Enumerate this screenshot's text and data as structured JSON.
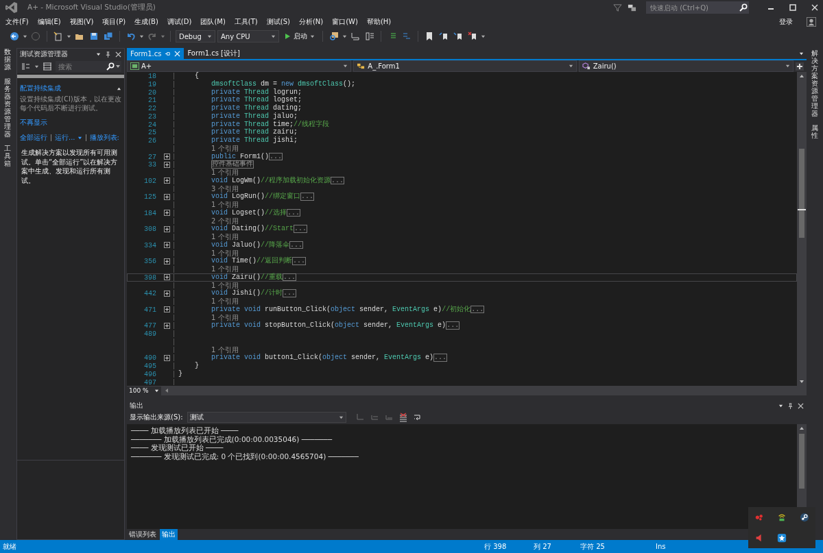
{
  "window": {
    "title": "A+ - Microsoft Visual Studio(管理员)",
    "quick_launch": {
      "placeholder": "快速启动 (Ctrl+Q)"
    },
    "sign_in": "登录"
  },
  "menu": [
    "文件(F)",
    "编辑(E)",
    "视图(V)",
    "项目(P)",
    "生成(B)",
    "调试(D)",
    "团队(M)",
    "工具(T)",
    "测试(S)",
    "分析(N)",
    "窗口(W)",
    "帮助(H)"
  ],
  "toolbar": {
    "configuration": "Debug",
    "platform": "Any CPU",
    "start": "启动"
  },
  "left_strip": [
    "数据源",
    "服务器资源管理器",
    "工具箱"
  ],
  "right_strip": [
    "解决方案资源管理器",
    "属性"
  ],
  "test_explorer": {
    "title": "测试资源管理器",
    "search": {
      "placeholder": "搜索"
    },
    "progress": {
      "level": 1
    },
    "notice_title": "配置持续集成",
    "notice_text": "设置持续集成(CI)版本，以在更改每个代码后不断进行测试。",
    "dismiss": "不再显示",
    "actions": [
      "全部运行",
      "运行...",
      "播放列表:"
    ],
    "message": "生成解决方案以发现所有可用测试。单击“全部运行”以在解决方案中生成、发现和运行所有测试。"
  },
  "editor_tabs": [
    {
      "label": "Form1.cs",
      "selected": true
    },
    {
      "label": "Form1.cs [设计]",
      "selected": false
    }
  ],
  "nav_bar": {
    "project": "A+",
    "class": "A_.Form1",
    "member": "Zairu()"
  },
  "code": [
    {
      "kind": "code",
      "num": "18",
      "folded": false,
      "current": false,
      "tokens": [
        {
          "kind": "text",
          "text": "    {"
        }
      ]
    },
    {
      "kind": "code",
      "num": "19",
      "folded": false,
      "current": false,
      "tokens": [
        {
          "kind": "type",
          "text": "        dmsoftClass"
        },
        {
          "kind": "text",
          "text": " dm = "
        },
        {
          "kind": "kw",
          "text": "new"
        },
        {
          "kind": "type",
          "text": " dmsoftClass"
        },
        {
          "kind": "text",
          "text": "();"
        }
      ]
    },
    {
      "kind": "code",
      "num": "20",
      "folded": false,
      "current": false,
      "tokens": [
        {
          "kind": "kw",
          "text": "        private"
        },
        {
          "kind": "type",
          "text": " Thread"
        },
        {
          "kind": "text",
          "text": " logrun;"
        }
      ]
    },
    {
      "kind": "code",
      "num": "21",
      "folded": false,
      "current": false,
      "tokens": [
        {
          "kind": "kw",
          "text": "        private"
        },
        {
          "kind": "type",
          "text": " Thread"
        },
        {
          "kind": "text",
          "text": " logset;"
        }
      ]
    },
    {
      "kind": "code",
      "num": "22",
      "folded": false,
      "current": false,
      "tokens": [
        {
          "kind": "kw",
          "text": "        private"
        },
        {
          "kind": "type",
          "text": " Thread"
        },
        {
          "kind": "text",
          "text": " dating;"
        }
      ]
    },
    {
      "kind": "code",
      "num": "23",
      "folded": false,
      "current": false,
      "tokens": [
        {
          "kind": "kw",
          "text": "        private"
        },
        {
          "kind": "type",
          "text": " Thread"
        },
        {
          "kind": "text",
          "text": " jaluo;"
        }
      ]
    },
    {
      "kind": "code",
      "num": "24",
      "folded": false,
      "current": false,
      "tokens": [
        {
          "kind": "kw",
          "text": "        private"
        },
        {
          "kind": "type",
          "text": " Thread"
        },
        {
          "kind": "text",
          "text": " time;"
        },
        {
          "kind": "comment",
          "text": "//线程字段"
        }
      ]
    },
    {
      "kind": "code",
      "num": "25",
      "folded": false,
      "current": false,
      "tokens": [
        {
          "kind": "kw",
          "text": "        private"
        },
        {
          "kind": "type",
          "text": " Thread"
        },
        {
          "kind": "text",
          "text": " zairu;"
        }
      ]
    },
    {
      "kind": "code",
      "num": "26",
      "folded": false,
      "current": false,
      "tokens": [
        {
          "kind": "kw",
          "text": "        private"
        },
        {
          "kind": "type",
          "text": " Thread"
        },
        {
          "kind": "text",
          "text": " jishi;"
        }
      ]
    },
    {
      "kind": "lens",
      "text": "1 个引用"
    },
    {
      "kind": "code",
      "num": "27",
      "folded": true,
      "current": false,
      "tokens": [
        {
          "kind": "kw",
          "text": "        public"
        },
        {
          "kind": "text",
          "text": " Form1()"
        },
        {
          "kind": "collapsed",
          "text": "..."
        }
      ]
    },
    {
      "kind": "code",
      "num": "33",
      "folded": true,
      "current": false,
      "tokens": [
        {
          "kind": "region",
          "text": "控件基础事件"
        }
      ]
    },
    {
      "kind": "lens",
      "text": "1 个引用"
    },
    {
      "kind": "code",
      "num": "102",
      "folded": true,
      "current": false,
      "tokens": [
        {
          "kind": "kw",
          "text": "        void"
        },
        {
          "kind": "text",
          "text": " LogWm()"
        },
        {
          "kind": "comment",
          "text": "//程序加载初始化资源"
        },
        {
          "kind": "collapsed",
          "text": "..."
        }
      ]
    },
    {
      "kind": "lens",
      "text": "3 个引用"
    },
    {
      "kind": "code",
      "num": "125",
      "folded": true,
      "current": false,
      "tokens": [
        {
          "kind": "kw",
          "text": "        void"
        },
        {
          "kind": "text",
          "text": " LogRun()"
        },
        {
          "kind": "comment",
          "text": "//绑定窗口"
        },
        {
          "kind": "collapsed",
          "text": "..."
        }
      ]
    },
    {
      "kind": "lens",
      "text": "1 个引用"
    },
    {
      "kind": "code",
      "num": "184",
      "folded": true,
      "current": false,
      "tokens": [
        {
          "kind": "kw",
          "text": "        void"
        },
        {
          "kind": "text",
          "text": " Logset()"
        },
        {
          "kind": "comment",
          "text": "//选择"
        },
        {
          "kind": "collapsed",
          "text": "..."
        }
      ]
    },
    {
      "kind": "lens",
      "text": "2 个引用"
    },
    {
      "kind": "code",
      "num": "308",
      "folded": true,
      "current": false,
      "tokens": [
        {
          "kind": "kw",
          "text": "        void"
        },
        {
          "kind": "text",
          "text": " Dating()"
        },
        {
          "kind": "comment",
          "text": "//Start"
        },
        {
          "kind": "collapsed",
          "text": "..."
        }
      ]
    },
    {
      "kind": "lens",
      "text": "1 个引用"
    },
    {
      "kind": "code",
      "num": "334",
      "folded": true,
      "current": false,
      "tokens": [
        {
          "kind": "kw",
          "text": "        void"
        },
        {
          "kind": "text",
          "text": " Jaluo()"
        },
        {
          "kind": "comment",
          "text": "//降落伞"
        },
        {
          "kind": "collapsed",
          "text": "..."
        }
      ]
    },
    {
      "kind": "lens",
      "text": "1 个引用"
    },
    {
      "kind": "code",
      "num": "356",
      "folded": true,
      "current": false,
      "tokens": [
        {
          "kind": "kw",
          "text": "        void"
        },
        {
          "kind": "text",
          "text": " Time()"
        },
        {
          "kind": "comment",
          "text": "//返回判断"
        },
        {
          "kind": "collapsed",
          "text": "..."
        }
      ]
    },
    {
      "kind": "lens",
      "text": "1 个引用"
    },
    {
      "kind": "code",
      "num": "398",
      "folded": true,
      "current": true,
      "tokens": [
        {
          "kind": "kw",
          "text": "        void"
        },
        {
          "kind": "text",
          "text": " Zairu()"
        },
        {
          "kind": "comment",
          "text": "//重载"
        },
        {
          "kind": "collapsed",
          "text": "..."
        }
      ]
    },
    {
      "kind": "lens",
      "text": "1 个引用"
    },
    {
      "kind": "code",
      "num": "442",
      "folded": true,
      "current": false,
      "tokens": [
        {
          "kind": "kw",
          "text": "        void"
        },
        {
          "kind": "text",
          "text": " Jishi()"
        },
        {
          "kind": "comment",
          "text": "//计时"
        },
        {
          "kind": "collapsed",
          "text": "..."
        }
      ]
    },
    {
      "kind": "lens",
      "text": "1 个引用"
    },
    {
      "kind": "code",
      "num": "471",
      "folded": true,
      "current": false,
      "tokens": [
        {
          "kind": "kw",
          "text": "        private void"
        },
        {
          "kind": "text",
          "text": " runButton_Click("
        },
        {
          "kind": "kw",
          "text": "object"
        },
        {
          "kind": "text",
          "text": " sender, "
        },
        {
          "kind": "type",
          "text": "EventArgs"
        },
        {
          "kind": "text",
          "text": " e)"
        },
        {
          "kind": "comment",
          "text": "//初始化"
        },
        {
          "kind": "collapsed",
          "text": "..."
        }
      ]
    },
    {
      "kind": "lens",
      "text": "1 个引用"
    },
    {
      "kind": "code",
      "num": "477",
      "folded": true,
      "current": false,
      "tokens": [
        {
          "kind": "kw",
          "text": "        private void"
        },
        {
          "kind": "text",
          "text": " stopButton_Click("
        },
        {
          "kind": "kw",
          "text": "object"
        },
        {
          "kind": "text",
          "text": " sender, "
        },
        {
          "kind": "type",
          "text": "EventArgs"
        },
        {
          "kind": "text",
          "text": " e)"
        },
        {
          "kind": "collapsed",
          "text": "..."
        }
      ]
    },
    {
      "kind": "code",
      "num": "489",
      "folded": false,
      "current": false
    },
    {
      "kind": "blank"
    },
    {
      "kind": "lens",
      "text": "1 个引用"
    },
    {
      "kind": "code",
      "num": "490",
      "folded": true,
      "current": false,
      "tokens": [
        {
          "kind": "kw",
          "text": "        private void"
        },
        {
          "kind": "text",
          "text": " button1_Click("
        },
        {
          "kind": "kw",
          "text": "object"
        },
        {
          "kind": "text",
          "text": " sender, "
        },
        {
          "kind": "type",
          "text": "EventArgs"
        },
        {
          "kind": "text",
          "text": " e)"
        },
        {
          "kind": "collapsed",
          "text": "..."
        }
      ]
    },
    {
      "kind": "code",
      "num": "495",
      "folded": false,
      "current": false,
      "tokens": [
        {
          "kind": "text",
          "text": "    }"
        }
      ]
    },
    {
      "kind": "code",
      "num": "496",
      "folded": false,
      "current": false,
      "tokens": [
        {
          "kind": "text",
          "text": "}"
        }
      ]
    },
    {
      "kind": "code",
      "num": "497",
      "folded": false,
      "current": false
    }
  ],
  "zoom": "100 %",
  "output": {
    "title": "输出",
    "source_label": "显示输出来源(S):",
    "source": "测试",
    "lines": [
      "──── 加载播放列表已开始 ────",
      "─────── 加载播放列表已完成(0:00:00.0035046) ───────",
      "──── 发现测试已开始 ────",
      "─────── 发现测试已完成: 0 个已找到(0:00:00.4565704) ───────"
    ]
  },
  "bottom_tabs": [
    {
      "label": "错误列表",
      "selected": false
    },
    {
      "label": "输出",
      "selected": true
    }
  ],
  "status_bar": {
    "state": "就绪",
    "line": "行 398",
    "column": "列 27",
    "char": "字符 25",
    "mode": "Ins"
  }
}
